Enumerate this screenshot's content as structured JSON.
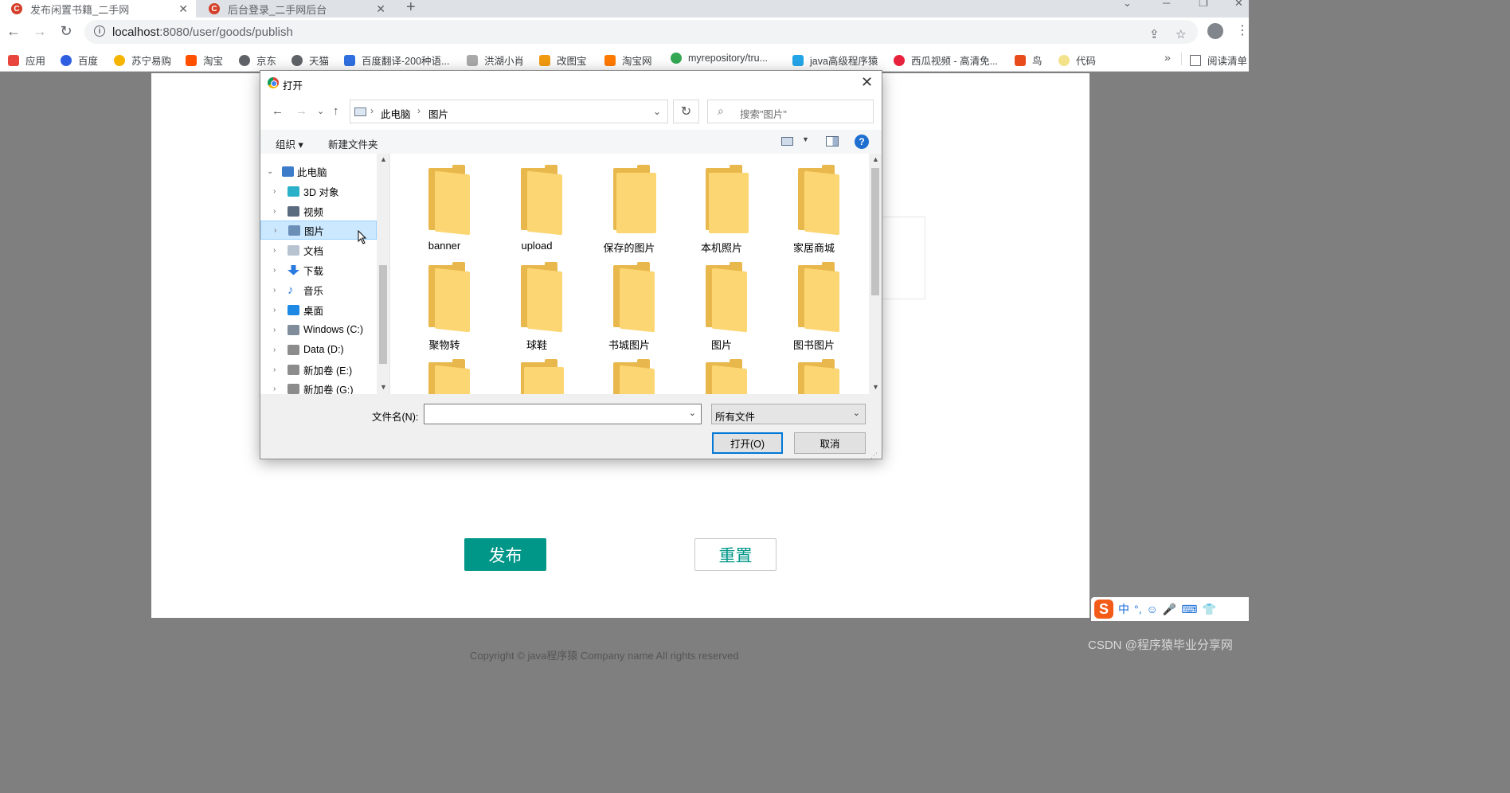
{
  "browser": {
    "tabs": [
      {
        "title": "发布闲置书籍_二手网",
        "favicon_letter": "C"
      },
      {
        "title": "后台登录_二手网后台",
        "favicon_letter": "C"
      }
    ],
    "new_tab": "+",
    "url_host": "localhost",
    "url_rest": ":8080/user/goods/publish",
    "bookmarks": [
      {
        "label": "应用",
        "color": "#e8453c"
      },
      {
        "label": "百度",
        "color": "#2f5fe0"
      },
      {
        "label": "苏宁易购",
        "color": "#f5b400"
      },
      {
        "label": "淘宝",
        "color": "#ff5000"
      },
      {
        "label": "京东",
        "color": "#5f6368"
      },
      {
        "label": "天猫",
        "color": "#5f6368"
      },
      {
        "label": "百度翻译-200种语...",
        "color": "#2f6fe0"
      },
      {
        "label": "洪湖小肖",
        "color": "#777777"
      },
      {
        "label": "改图宝",
        "color": "#f29b12"
      },
      {
        "label": "淘宝网",
        "color": "#ff7a00"
      },
      {
        "label": "myrepository/tru...",
        "color": "#34a853"
      },
      {
        "label": "java高级程序猿",
        "color": "#23a6e8"
      },
      {
        "label": "西瓜视频 - 高清免...",
        "color": "#e8223c"
      },
      {
        "label": "鸟",
        "color": "#e84c1a"
      },
      {
        "label": "代码",
        "color": "#f3e28b"
      }
    ],
    "bookmarks_more": "»",
    "reading_list": "阅读清单"
  },
  "page": {
    "publish_label": "发布",
    "reset_label": "重置",
    "footer": "Copyright © java程序猿 Company name All rights reserved",
    "watermark": "CSDN @程序猿毕业分享网"
  },
  "ime": {
    "logo": "S",
    "items": [
      "中",
      "°,",
      "☺",
      "🎤",
      "⌨",
      "👕"
    ]
  },
  "dialog": {
    "title": "打开",
    "path": [
      "此电脑",
      "图片"
    ],
    "search_placeholder": "搜索\"图片\"",
    "organize": "组织 ▾",
    "new_folder": "新建文件夹",
    "tree": [
      {
        "label": "此电脑",
        "root": true,
        "expanded": true,
        "color": "#3d7cc9"
      },
      {
        "label": "3D 对象",
        "color": "#2ab0c9"
      },
      {
        "label": "视频",
        "color": "#5a6b7f"
      },
      {
        "label": "图片",
        "selected": true,
        "color": "#6c8fb8"
      },
      {
        "label": "文档",
        "color": "#b7c3d1"
      },
      {
        "label": "下载",
        "color": "#2a7be0"
      },
      {
        "label": "音乐",
        "color": "#2a7be0"
      },
      {
        "label": "桌面",
        "color": "#1e88e5"
      },
      {
        "label": "Windows (C:)",
        "color": "#7f8c99"
      },
      {
        "label": "Data (D:)",
        "color": "#8c8c8c"
      },
      {
        "label": "新加卷 (E:)",
        "color": "#8c8c8c"
      },
      {
        "label": "新加卷 (G:)",
        "color": "#8c8c8c"
      }
    ],
    "folders": [
      {
        "label": "banner",
        "paper": "#3b7be8"
      },
      {
        "label": "upload",
        "paper": "#2a2a2a"
      },
      {
        "label": "保存的图片",
        "paper": ""
      },
      {
        "label": "本机照片",
        "paper": ""
      },
      {
        "label": "家居商城",
        "paper": "#9fd6d2"
      },
      {
        "label": "聚物转",
        "paper": "#8a6a50"
      },
      {
        "label": "球鞋",
        "paper": "#3a3a3a"
      },
      {
        "label": "书城图片",
        "paper": "#f2ece4"
      },
      {
        "label": "图片",
        "paper": "#dde4ea"
      },
      {
        "label": "图书图片",
        "paper": "#f3f0ec"
      },
      {
        "label": "",
        "paper": "#c0392b"
      },
      {
        "label": "",
        "paper": ""
      },
      {
        "label": "",
        "paper": "#e8e2dc"
      },
      {
        "label": "",
        "paper": "#111111"
      },
      {
        "label": "",
        "paper": "#b03030"
      }
    ],
    "filename_label": "文件名(N):",
    "filename_value": "",
    "filetype": "所有文件",
    "open_label": "打开(O)",
    "cancel_label": "取消"
  }
}
